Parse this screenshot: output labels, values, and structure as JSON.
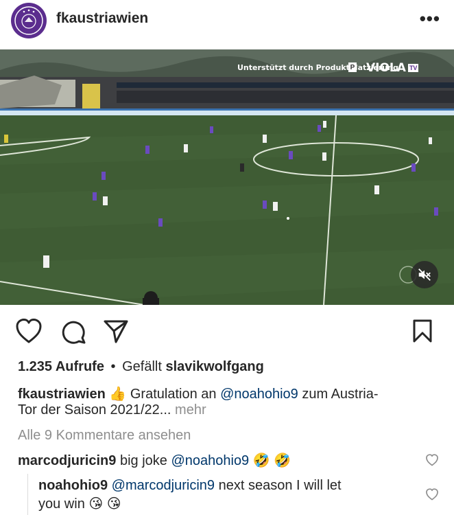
{
  "header": {
    "username": "fkaustriawien",
    "more_icon": "more-dots-icon"
  },
  "video": {
    "sponsor_text": "Unterstützt durch Produktplatzierung",
    "sponsor_badge": "P",
    "channel_logo": "VIOLA",
    "channel_logo_tv": "TV",
    "mute_icon": "speaker-muted-icon",
    "colors": {
      "pitch": "#3d5a33",
      "home_kit": "#6a4bbf",
      "away_kit": "#f2f2f2"
    }
  },
  "actions": {
    "like_icon": "heart-icon",
    "comment_icon": "comment-icon",
    "share_icon": "paper-plane-icon",
    "save_icon": "bookmark-icon"
  },
  "stats": {
    "views": "1.235 Aufrufe",
    "separator": "•",
    "liked_by_prefix": "Gefällt",
    "liked_by_user": "slavikwolfgang"
  },
  "caption": {
    "username": "fkaustriawien",
    "emoji": "👍",
    "text_before_mention": "Gratulation an",
    "mention": "@noahohio9",
    "text_after_mention": "zum Austria-",
    "line2": "Tor der Saison 2021/22...",
    "more_label": "mehr"
  },
  "view_comments_label": "Alle 9 Kommentare ansehen",
  "comments": [
    {
      "username": "marcodjuricin9",
      "text": "big joke",
      "mention": "@noahohio9",
      "emoji": "🤣 🤣"
    }
  ],
  "reply": {
    "username": "noahohio9",
    "mention": "@marcodjuricin9",
    "text": "next season I will let",
    "line2": "you win",
    "emoji": "😘 😘"
  },
  "colors": {
    "text": "#262626",
    "link": "#00376b",
    "muted": "#8e8e8e",
    "club_purple": "#5b2d8e"
  }
}
